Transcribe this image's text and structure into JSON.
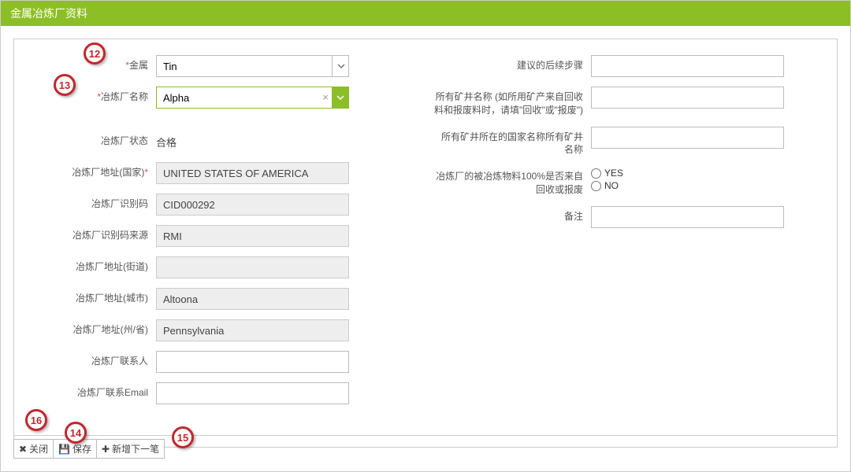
{
  "header": {
    "title": "金属冶炼厂资料"
  },
  "left": {
    "metal": {
      "label": "金属",
      "value": "Tin"
    },
    "smelter_name": {
      "label": "冶炼厂名称",
      "value": "Alpha"
    },
    "status": {
      "label": "冶炼厂状态",
      "value": "合格"
    },
    "country": {
      "label": "冶炼厂地址(国家)",
      "value": "UNITED STATES OF AMERICA"
    },
    "cid": {
      "label": "冶炼厂识别码",
      "value": "CID000292"
    },
    "cid_source": {
      "label": "冶炼厂识别码来源",
      "value": "RMI"
    },
    "street": {
      "label": "冶炼厂地址(街道)",
      "value": ""
    },
    "city": {
      "label": "冶炼厂地址(城市)",
      "value": "Altoona"
    },
    "state": {
      "label": "冶炼厂地址(州/省)",
      "value": "Pennsylvania"
    },
    "contact": {
      "label": "冶炼厂联系人",
      "value": ""
    },
    "email": {
      "label": "冶炼厂联系Email",
      "value": ""
    }
  },
  "right": {
    "next_steps": {
      "label": "建议的后续步骤",
      "value": ""
    },
    "mine_names": {
      "label": "所有矿井名称 (如所用矿产来自回收料和报废料时，请填\"回收\"或\"报废\")",
      "value": ""
    },
    "mine_country": {
      "label": "所有矿井所在的国家名称所有矿井名称",
      "value": ""
    },
    "recycled": {
      "label": "冶炼厂的被冶炼物料100%是否来自回收或报废",
      "yes": "YES",
      "no": "NO"
    },
    "comments": {
      "label": "备注",
      "value": ""
    }
  },
  "footer": {
    "close": "关闭",
    "save": "保存",
    "add_next": "新增下一笔"
  },
  "callouts": {
    "c12": "12",
    "c13": "13",
    "c14": "14",
    "c15": "15",
    "c16": "16"
  }
}
